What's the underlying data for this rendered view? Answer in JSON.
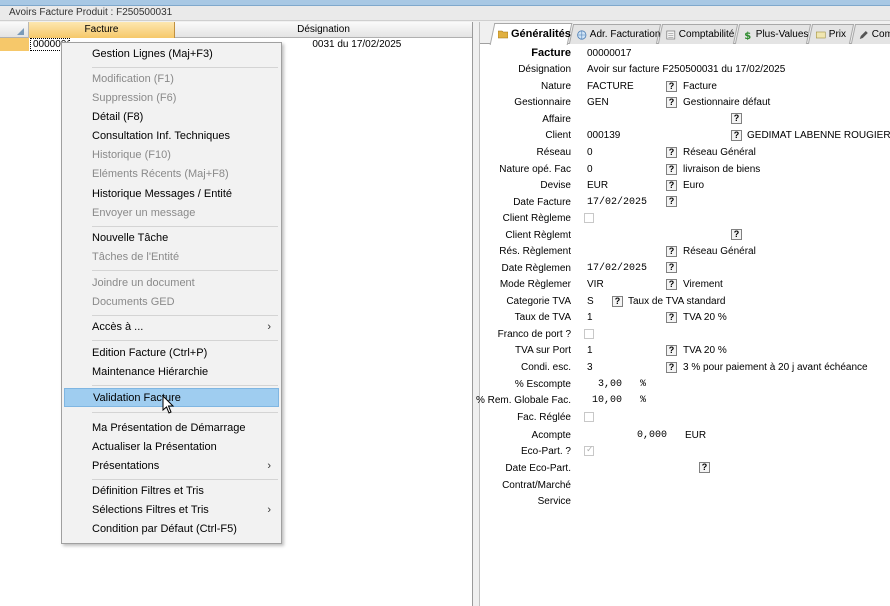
{
  "window": {
    "title": "Avoirs Facture Produit : F250500031"
  },
  "grid": {
    "columns": [
      "Facture",
      "Désignation"
    ],
    "row": {
      "facture": "00000017",
      "designation": "Avoir sur facture F250500031 du 17/02/2025",
      "designation_visible": "0031 du 17/02/2025"
    }
  },
  "menu": {
    "items": [
      {
        "label": "Gestion Lignes (Maj+F3)",
        "disabled": false
      },
      {
        "label": "Modification (F1)",
        "disabled": true
      },
      {
        "label": "Suppression (F6)",
        "disabled": true
      },
      {
        "label": "Détail (F8)",
        "disabled": false
      },
      {
        "label": "Consultation Inf. Techniques",
        "disabled": false
      },
      {
        "label": "Historique (F10)",
        "disabled": true
      },
      {
        "label": "Eléments Récents (Maj+F8)",
        "disabled": true
      },
      {
        "label": "Historique Messages / Entité",
        "disabled": false
      },
      {
        "label": "Envoyer un message",
        "disabled": true
      },
      {
        "label": "Nouvelle Tâche",
        "disabled": false
      },
      {
        "label": "Tâches de l'Entité",
        "disabled": true
      },
      {
        "label": "Joindre un document",
        "disabled": true
      },
      {
        "label": "Documents GED",
        "disabled": true
      },
      {
        "label": "Accès à ...",
        "disabled": false
      },
      {
        "label": "Edition Facture (Ctrl+P)",
        "disabled": false
      },
      {
        "label": "Maintenance Hiérarchie",
        "disabled": false
      },
      {
        "label": "Validation Facture",
        "disabled": false,
        "highlighted": true
      },
      {
        "label": "Ma Présentation de Démarrage",
        "disabled": false
      },
      {
        "label": "Actualiser la Présentation",
        "disabled": false
      },
      {
        "label": "Présentations",
        "disabled": false
      },
      {
        "label": "Définition Filtres et Tris",
        "disabled": false
      },
      {
        "label": "Sélections Filtres et Tris",
        "disabled": false
      },
      {
        "label": "Condition par Défaut (Ctrl-F5)",
        "disabled": false
      }
    ]
  },
  "tabs": [
    {
      "label": "Généralités",
      "icon": "folder-icon"
    },
    {
      "label": "Adr. Facturation",
      "icon": "globe-icon"
    },
    {
      "label": "Comptabilité",
      "icon": "ledger-icon"
    },
    {
      "label": "Plus-Values",
      "icon": "dollar-icon"
    },
    {
      "label": "Prix",
      "icon": "price-icon"
    },
    {
      "label": "Comm",
      "icon": "pencil-icon"
    }
  ],
  "form": {
    "facture": {
      "label": "Facture",
      "value": "00000017"
    },
    "designation": {
      "label": "Désignation",
      "value": "Avoir sur facture F250500031 du 17/02/2025"
    },
    "nature": {
      "label": "Nature",
      "value": "FACTURE",
      "desc": "Facture"
    },
    "gestionnaire": {
      "label": "Gestionnaire",
      "value": "GEN",
      "desc": "Gestionnaire défaut"
    },
    "affaire": {
      "label": "Affaire"
    },
    "client": {
      "label": "Client",
      "value": "000139",
      "desc": "GEDIMAT LABENNE ROUGIER F"
    },
    "reseau": {
      "label": "Réseau",
      "value": "0",
      "desc": "Réseau Général"
    },
    "nature_ope": {
      "label": "Nature opé. Fac",
      "value": "0",
      "desc": "livraison de biens"
    },
    "devise": {
      "label": "Devise",
      "value": "EUR",
      "desc": "Euro"
    },
    "date_facture": {
      "label": "Date Facture",
      "value": "17/02/2025"
    },
    "client_reglement": {
      "label": "Client Règleme"
    },
    "client_reglemt": {
      "label": "Client Règlemt"
    },
    "res_reglement": {
      "label": "Rés. Règlement",
      "desc": "Réseau Général"
    },
    "date_reglement": {
      "label": "Date Règlemen",
      "value": "17/02/2025"
    },
    "mode_reglement": {
      "label": "Mode Règlemer",
      "value": "VIR",
      "desc": "Virement"
    },
    "categorie_tva": {
      "label": "Categorie TVA",
      "value": "S",
      "desc": "Taux de TVA standard"
    },
    "taux_tva": {
      "label": "Taux de TVA",
      "value": "1",
      "desc": "TVA 20 %"
    },
    "franco": {
      "label": "Franco de port ?"
    },
    "tva_port": {
      "label": "TVA sur Port",
      "value": "1",
      "desc": "TVA 20 %"
    },
    "condi_esc": {
      "label": "Condi. esc.",
      "value": "3",
      "desc": "3 % pour paiement à 20 j avant échéance"
    },
    "escompte": {
      "label": "% Escompte",
      "value": "3,00",
      "unit": "%"
    },
    "rem_globale": {
      "label": "% Rem. Globale Fac.",
      "value": "10,00",
      "unit": "%"
    },
    "fac_reglee": {
      "label": "Fac. Réglée"
    },
    "acompte": {
      "label": "Acompte",
      "value": "0,000",
      "unit": "EUR"
    },
    "eco_part": {
      "label": "Eco-Part. ?"
    },
    "date_eco_part": {
      "label": "Date Eco-Part."
    },
    "contrat": {
      "label": "Contrat/Marché"
    },
    "service": {
      "label": "Service"
    },
    "help_glyph": "?"
  }
}
